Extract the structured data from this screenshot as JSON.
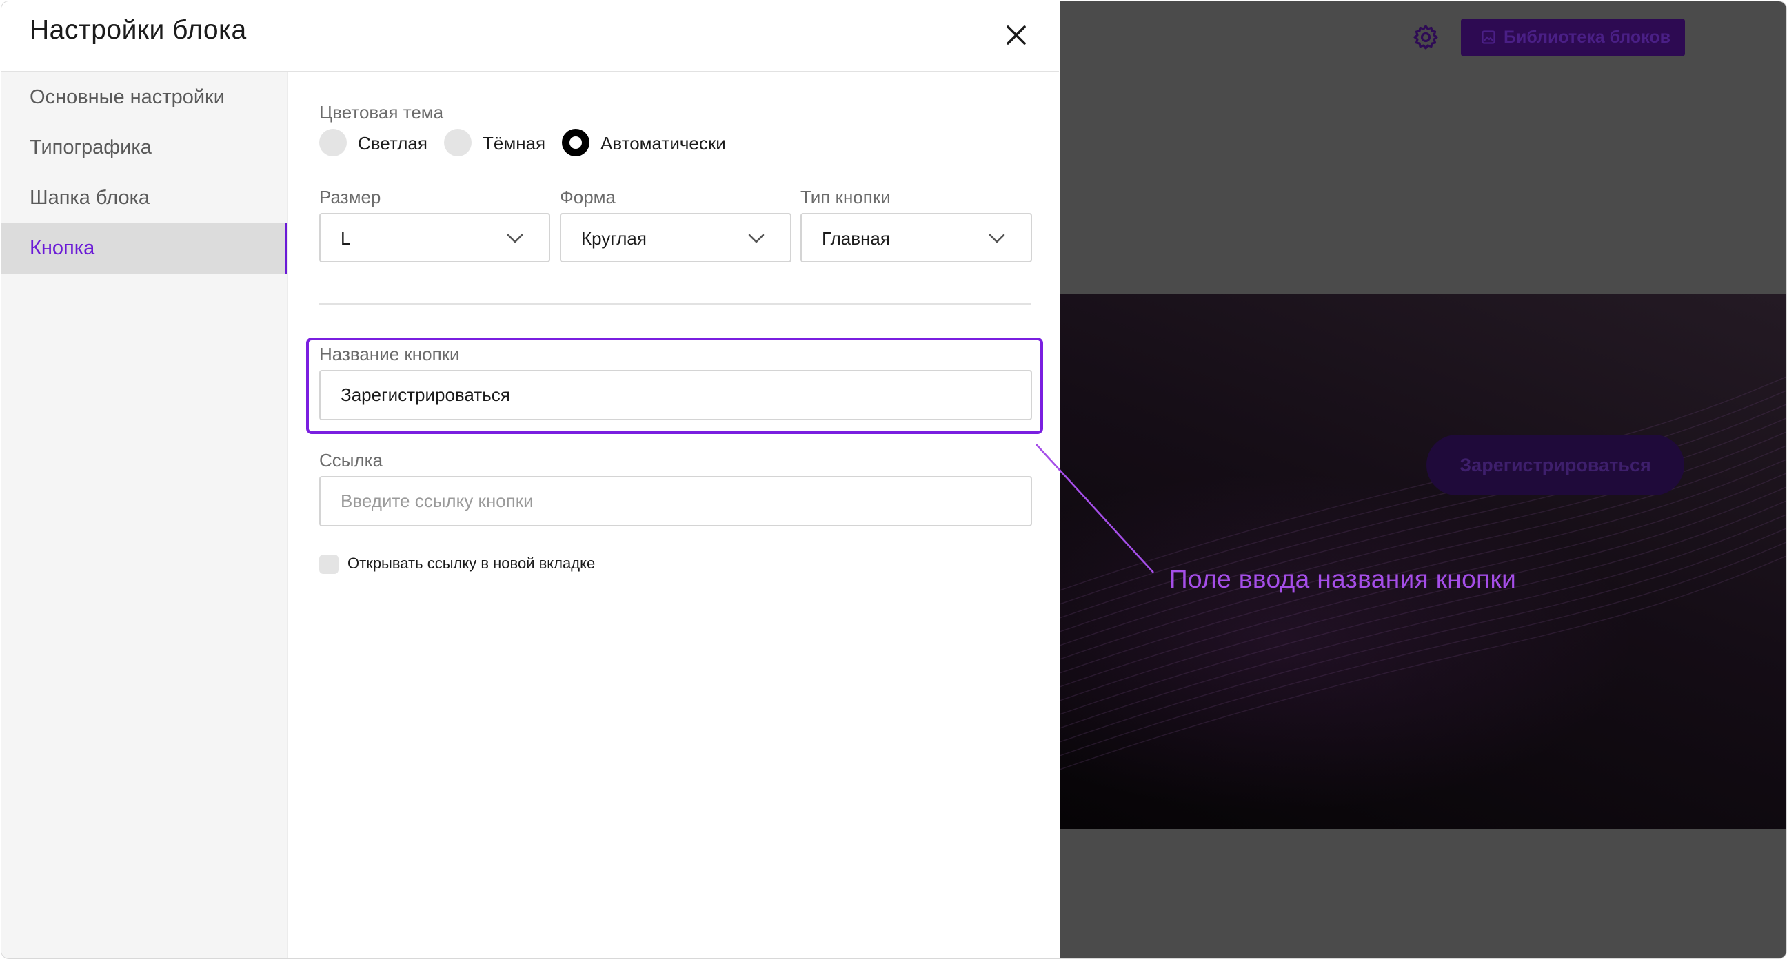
{
  "modal": {
    "title": "Настройки блока"
  },
  "sidebar": {
    "items": [
      {
        "label": "Основные настройки"
      },
      {
        "label": "Типографика"
      },
      {
        "label": "Шапка блока"
      },
      {
        "label": "Кнопка",
        "active": true
      }
    ]
  },
  "color_theme": {
    "label": "Цветовая тема",
    "options": [
      "Светлая",
      "Тёмная",
      "Автоматически"
    ],
    "selected": "Автоматически"
  },
  "size": {
    "label": "Размер",
    "value": "L"
  },
  "shape": {
    "label": "Форма",
    "value": "Круглая"
  },
  "button_type": {
    "label": "Тип кнопки",
    "value": "Главная"
  },
  "button_name": {
    "label": "Название кнопки",
    "value": "Зарегистрироваться"
  },
  "link": {
    "label": "Ссылка",
    "placeholder": "Введите ссылку кнопки"
  },
  "open_new_tab": {
    "label": "Открывать ссылку в новой вкладке",
    "checked": false
  },
  "preview": {
    "library_button": "Библиотека блоков",
    "hero_button": "Зарегистрироваться"
  },
  "annotation": {
    "text": "Поле ввода названия кнопки"
  },
  "colors": {
    "accent": "#6a1ad6",
    "highlight": "#7a1fe0",
    "callout": "#a54ee8",
    "preview_bg": "#4b4b4b"
  },
  "icons": [
    "close-icon",
    "chevron-down-icon",
    "gear-icon",
    "library-icon"
  ]
}
